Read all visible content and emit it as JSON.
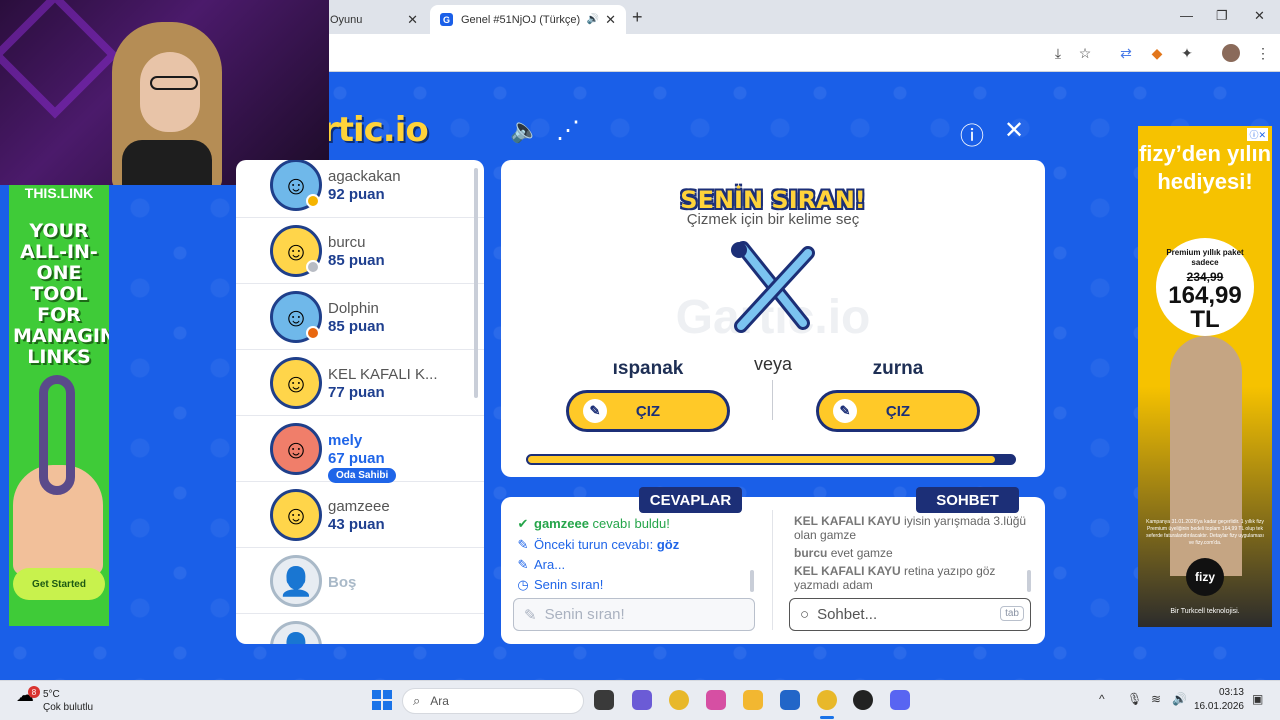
{
  "browser": {
    "tabs": [
      {
        "title": "Oyunu",
        "active": false
      },
      {
        "title": "Genel #51NjOJ (Türkçe) - G",
        "active": true
      }
    ],
    "new_tab_icon": "plus-icon"
  },
  "game": {
    "logo": "artic.io",
    "turn_title": "SENİN SIRAN!",
    "turn_subtitle": "Çizmek için bir kelime seç",
    "watermark": "Gartic.io",
    "word_left": "ıspanak",
    "or_label": "veya",
    "word_right": "zurna",
    "draw_label_left": "ÇIZ",
    "draw_label_right": "ÇIZ",
    "timer_fraction": 0.96,
    "colors": {
      "accent": "#ffc928",
      "navy": "#1c2f77",
      "bg": "#1a5fe8"
    }
  },
  "players": [
    {
      "name": "agackakan",
      "score": "92 puan",
      "avatar": "blue",
      "status": "#f5b400"
    },
    {
      "name": "burcu",
      "score": "85 puan",
      "avatar": "yellow",
      "status": "#b8bcc4"
    },
    {
      "name": "Dolphin",
      "score": "85 puan",
      "avatar": "blue",
      "status": "#e8670f"
    },
    {
      "name": "KEL KAFALI K...",
      "score": "77 puan",
      "avatar": "yellow",
      "status": ""
    },
    {
      "name": "mely",
      "score": "67 puan",
      "avatar": "red",
      "status": "",
      "owner_badge": "Oda Sahibi",
      "me": true
    },
    {
      "name": "gamzeee",
      "score": "43 puan",
      "avatar": "yellow",
      "status": ""
    },
    {
      "name": "Boş",
      "score": "",
      "avatar": "empty",
      "status": ""
    }
  ],
  "answers": {
    "tab_label": "CEVAPLAR",
    "lines": [
      {
        "icon": "check-icon",
        "user": "gamzeee",
        "text": "cevabı buldu!"
      },
      {
        "icon": "pencil-icon",
        "prefix": "Önceki turun cevabı:",
        "value": "göz"
      },
      {
        "icon": "pencil-icon",
        "text": "Ara..."
      },
      {
        "icon": "clock-icon",
        "text": "Senin sıran!"
      }
    ],
    "input_placeholder": "Senin sıran!"
  },
  "chat": {
    "tab_label": "SOHBET",
    "messages": [
      {
        "user": "KEL KAFALI KAYU",
        "text": "iyisin yarışmada 3.lüğü olan gamze"
      },
      {
        "user": "burcu",
        "text": "evet gamze"
      },
      {
        "user": "KEL KAFALI KAYU",
        "text": "retina yazıpo göz yazmadı adam"
      }
    ],
    "input_placeholder": "Sohbet...",
    "tab_key": "tab"
  },
  "ad_left": {
    "top_text": "THIS.LINK",
    "headline": "YOUR ALL-IN-ONE TOOL FOR MANAGING LINKS",
    "cta": "Get Started"
  },
  "ad_right": {
    "headline": "fizy’den yılın hediyesi!",
    "badge_line": "Premium yıllık paket sadece",
    "old_price": "234,99",
    "new_price": "164,99 TL",
    "fine_print": "Kampanya 31.01.2026'ya kadar geçerlidir. 1 yıllık fizy Premium üyeliğinin bedeli toplam 164,99 TL olup tek seferde faturalandırılacaktır. Detaylar fizy uygulaması ve fizy.com'da.",
    "brand": "fizy",
    "footer": "Bir Turkcell teknolojisi."
  },
  "taskbar": {
    "weather_temp": "5°C",
    "weather_desc": "Çok bulutlu",
    "weather_badge": "8",
    "search_label": "Ara",
    "time": "03:13",
    "date": "16.01.2026"
  }
}
